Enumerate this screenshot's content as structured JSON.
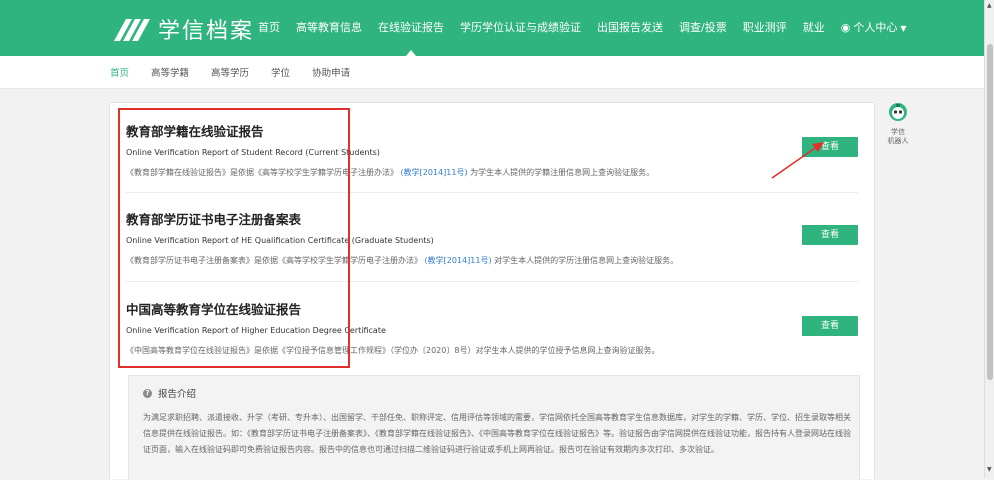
{
  "header": {
    "logo_text": "学信档案",
    "nav": [
      "首页",
      "高等教育信息",
      "在线验证报告",
      "学历学位认证与成绩验证",
      "出国报告发送",
      "调查/投票",
      "职业测评",
      "就业"
    ],
    "active_index": 2,
    "user_menu": "个人中心",
    "brand_color": "#2fb47f"
  },
  "subnav": {
    "items": [
      "首页",
      "高等学籍",
      "高等学历",
      "学位",
      "协助申请"
    ],
    "active_index": 0
  },
  "reports": [
    {
      "title": "教育部学籍在线验证报告",
      "subtitle": "Online Verification Report of Student Record (Current Students)",
      "desc_before": "《教育部学籍在线验证报告》是依据《高等学校学生学籍学历电子注册办法》",
      "desc_link": "(教学[2014]11号)",
      "desc_after": "为学生本人提供的学籍注册信息网上查询验证服务。",
      "button": "查看"
    },
    {
      "title": "教育部学历证书电子注册备案表",
      "subtitle": "Online Verification Report of HE Qualification Certificate (Graduate Students)",
      "desc_before": "《教育部学历证书电子注册备案表》是依据《高等学校学生学籍学历电子注册办法》",
      "desc_link": "(教学[2014]11号)",
      "desc_after": "对学生本人提供的学历注册信息网上查询验证服务。",
      "button": "查看"
    },
    {
      "title": "中国高等教育学位在线验证报告",
      "subtitle": "Online Verification Report of Higher Education Degree Certificate",
      "desc_before": "《中国高等教育学位在线验证报告》是依据《学位授予信息管理工作规程》（学位办〔2020〕8号）对学生本人提供的学位授予信息网上查询验证服务。",
      "desc_link": "",
      "desc_after": "",
      "button": "查看"
    }
  ],
  "intro": {
    "title": "报告介绍",
    "body": "为满足求职招聘、派遣接收、升学（考研、专升本）、出国留学、干部任免、职称评定、信用评估等领域的需要，学信网依托全国高等教育学生信息数据库，对学生的学籍、学历、学位、招生录取等相关信息提供在线验证报告。如：《教育部学历证书电子注册备案表》、《教育部学籍在线验证报告》、《中国高等教育学位在线验证报告》等。验证报告由学信网提供在线验证功能，报告持有人登录网站在线验证页面，输入在线验证码即可免费验证报告内容。报告中的信息也可通过扫描二维验证码进行验证或手机上网再验证。报告可在验证有效期内多次打印、多次验证。"
  },
  "robot": {
    "label_line1": "学信",
    "label_line2": "机器人"
  },
  "annotation_color": "#e0302a"
}
